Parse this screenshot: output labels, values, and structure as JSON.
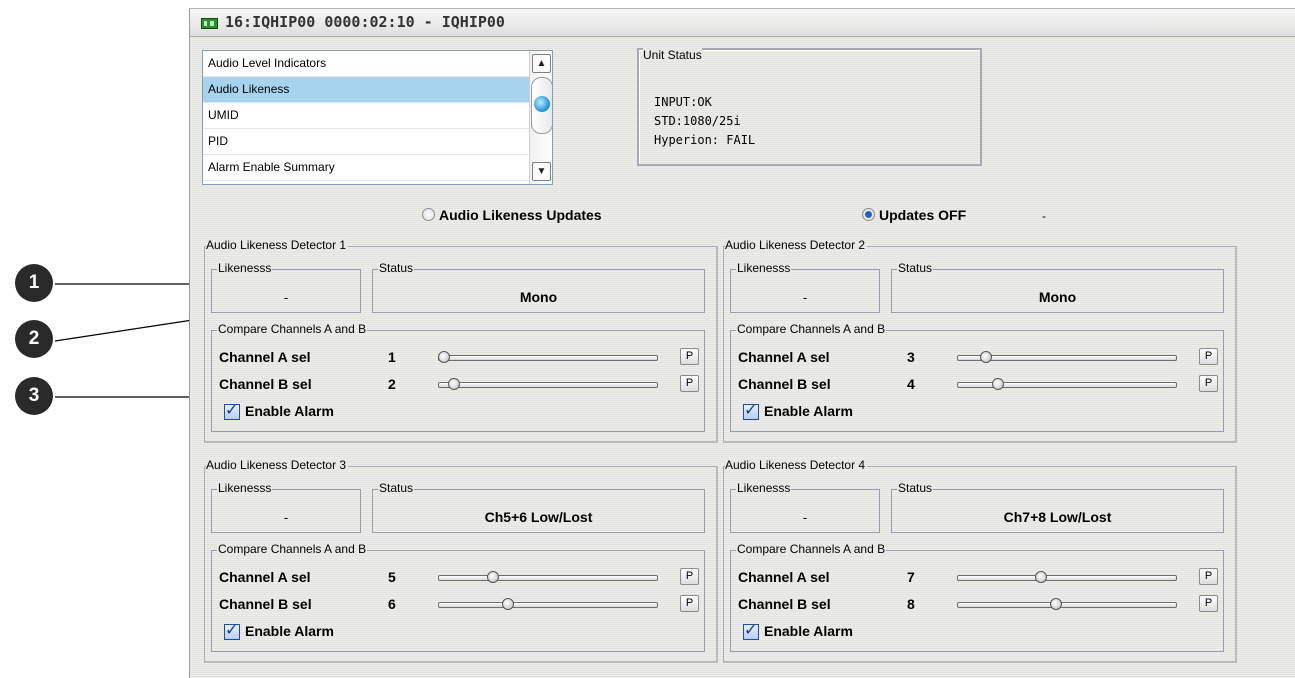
{
  "window": {
    "title": "16:IQHIP00 0000:02:10 - IQHIP00"
  },
  "menu_list": {
    "items": [
      "Audio Level Indicators",
      "Audio Likeness",
      "UMID",
      "PID",
      "Alarm Enable Summary"
    ],
    "selected_index": 1
  },
  "unit_status": {
    "title": "Unit Status",
    "lines": [
      "INPUT:OK",
      "STD:1080/25i",
      "Hyperion: FAIL"
    ]
  },
  "updates": {
    "option_on_label": "Audio Likeness Updates",
    "option_off_label": "Updates OFF",
    "selected": "Updates OFF",
    "indicator": "-"
  },
  "labels": {
    "likeness": "Likenesss",
    "status": "Status",
    "compare": "Compare Channels A and B",
    "channel_a": "Channel A sel",
    "channel_b": "Channel B sel",
    "enable_alarm": "Enable Alarm",
    "preset_button": "P"
  },
  "detectors": [
    {
      "title": "Audio Likeness Detector 1",
      "likeness": "-",
      "status": "Mono",
      "channel_a": "1",
      "channel_b": "2",
      "slider_a": 0.0,
      "slider_b": 0.05,
      "enable_alarm": true
    },
    {
      "title": "Audio Likeness Detector 2",
      "likeness": "-",
      "status": "Mono",
      "channel_a": "3",
      "channel_b": "4",
      "slider_a": 0.11,
      "slider_b": 0.17,
      "enable_alarm": true
    },
    {
      "title": "Audio Likeness Detector 3",
      "likeness": "-",
      "status": "Ch5+6 Low/Lost",
      "channel_a": "5",
      "channel_b": "6",
      "slider_a": 0.24,
      "slider_b": 0.31,
      "enable_alarm": true
    },
    {
      "title": "Audio Likeness Detector 4",
      "likeness": "-",
      "status": "Ch7+8 Low/Lost",
      "channel_a": "7",
      "channel_b": "8",
      "slider_a": 0.38,
      "slider_b": 0.45,
      "enable_alarm": true
    }
  ],
  "callouts": [
    "1",
    "2",
    "3"
  ],
  "colors": {
    "list_selection": "#a7d3ef",
    "callout": "#2a2a2a",
    "radio_selected": "#1d62c9"
  }
}
